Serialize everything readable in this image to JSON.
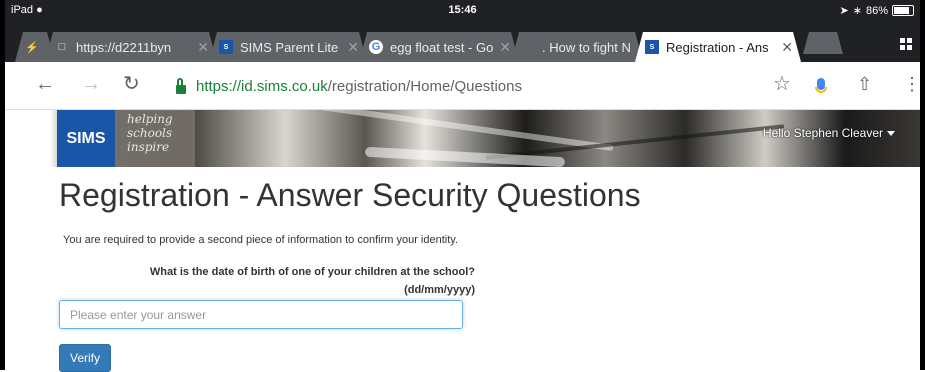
{
  "status_bar": {
    "device": "iPad",
    "time": "15:46",
    "battery": "86%"
  },
  "tabs": [
    {
      "title": "",
      "favicon": "flash-icon",
      "active": false
    },
    {
      "title": "https://d2211byn",
      "favicon": "page-icon",
      "active": false
    },
    {
      "title": "SIMS Parent Lite -",
      "favicon": "sims-icon",
      "active": false
    },
    {
      "title": "egg float test - Go",
      "favicon": "google-icon",
      "active": false
    },
    {
      "title": ". How to fight N",
      "favicon": "blank-icon",
      "active": false
    },
    {
      "title": "Registration - Ans",
      "favicon": "sims-icon",
      "active": true
    }
  ],
  "omnibox": {
    "scheme": "https://",
    "host": "id.sims.co.uk",
    "path": "/registration/Home/Questions"
  },
  "banner": {
    "logo_text": "SIMS",
    "tagline": [
      "helping",
      "schools",
      "inspire"
    ],
    "user_greeting": "Hello Stephen Cleaver"
  },
  "page": {
    "title": "Registration - Answer Security Questions",
    "intro": "You are required to provide a second piece of information to confirm your identity.",
    "question_line1": "What is the date of birth of one of your children at the school?",
    "question_line2": "(dd/mm/yyyy)",
    "answer_placeholder": "Please enter your answer",
    "answer_value": "",
    "verify_label": "Verify"
  },
  "colors": {
    "chrome_dark": "#202124",
    "sims_blue": "#1a56a8",
    "button_blue": "#337ab7",
    "secure_green": "#188038"
  }
}
